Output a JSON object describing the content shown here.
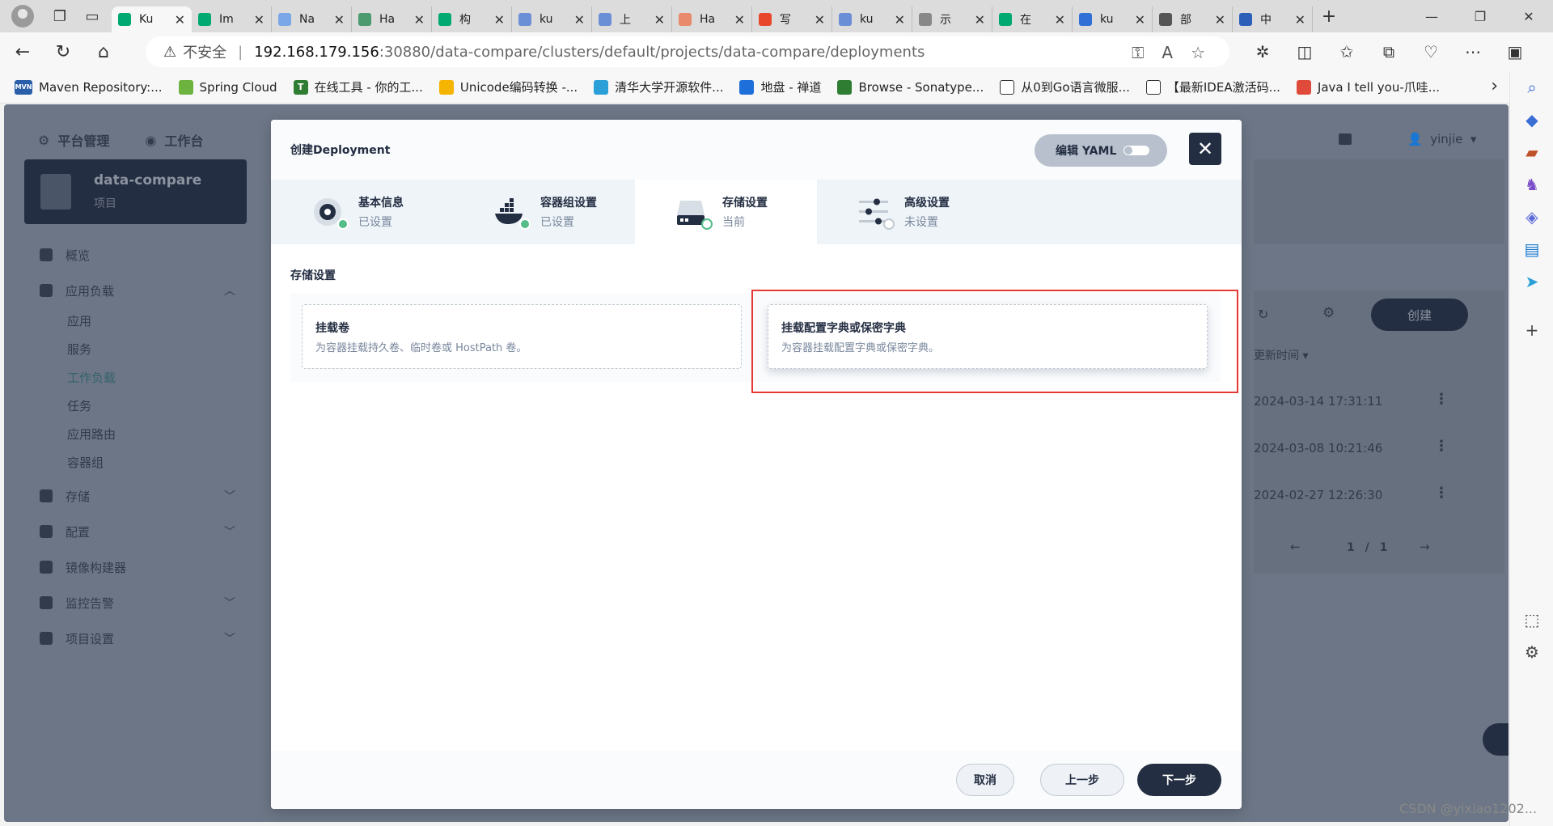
{
  "browser": {
    "tabs": [
      {
        "label": "Ku",
        "color": "#00a971",
        "active": true
      },
      {
        "label": "Im",
        "color": "#00a971"
      },
      {
        "label": "Na",
        "color": "#7aa7e8"
      },
      {
        "label": "Ha",
        "color": "#4b9b6e"
      },
      {
        "label": "构",
        "color": "#00a971"
      },
      {
        "label": "ku",
        "color": "#6b8fd6"
      },
      {
        "label": "上",
        "color": "#6b8fd6"
      },
      {
        "label": "Ha",
        "color": "#e88a6b"
      },
      {
        "label": "写",
        "color": "#e8472b"
      },
      {
        "label": "ku",
        "color": "#6b8fd6"
      },
      {
        "label": "示",
        "color": "#888888"
      },
      {
        "label": "在",
        "color": "#00a971"
      },
      {
        "label": "ku",
        "color": "#2f6fd6"
      },
      {
        "label": "部",
        "color": "#555555"
      },
      {
        "label": "中",
        "color": "#2b5fb8"
      }
    ],
    "url": {
      "warning": "不安全",
      "host": "192.168.179.156",
      "path": ":30880/data-compare/clusters/default/projects/data-compare/deployments"
    },
    "bookmarks": [
      {
        "label": "Maven Repository:...",
        "icon": "MVN",
        "color": "#2a5ea8"
      },
      {
        "label": "Spring Cloud",
        "icon": "",
        "color": "#6db33f"
      },
      {
        "label": "在线工具 - 你的工...",
        "icon": "T",
        "color": "#2e7d32"
      },
      {
        "label": "Unicode编码转换 -...",
        "icon": "",
        "color": "#f4b400"
      },
      {
        "label": "清华大学开源软件...",
        "icon": "",
        "color": "#2a9fd8"
      },
      {
        "label": "地盘 - 禅道",
        "icon": "",
        "color": "#1e6fd9"
      },
      {
        "label": "Browse - Sonatype...",
        "icon": "",
        "color": "#2e7d32"
      },
      {
        "label": "从0到Go语言微服...",
        "icon": "",
        "color": "#ffffff"
      },
      {
        "label": "【最新IDEA激活码...",
        "icon": "",
        "color": "#ffffff"
      },
      {
        "label": "Java I tell you-爪哇...",
        "icon": "",
        "color": "#e04a3a"
      }
    ]
  },
  "app": {
    "nav": {
      "platform": "平台管理",
      "workbench": "工作台",
      "user": "yinjie"
    },
    "project": {
      "name": "data-compare",
      "sub": "项目"
    },
    "menu": [
      {
        "label": "概览"
      },
      {
        "label": "应用负载",
        "expanded": true,
        "children": [
          "应用",
          "服务",
          "工作负载",
          "任务",
          "应用路由",
          "容器组"
        ]
      },
      {
        "label": "存储"
      },
      {
        "label": "配置"
      },
      {
        "label": "镜像构建器"
      },
      {
        "label": "监控告警"
      },
      {
        "label": "项目设置"
      }
    ],
    "bg": {
      "create": "创建",
      "update_col": "更新时间",
      "times": [
        "2024-03-14 17:31:11",
        "2024-03-08 10:21:46",
        "2024-02-27 12:26:30"
      ],
      "page": "1 / 1"
    }
  },
  "modal": {
    "title": "创建Deployment",
    "yaml": "编辑 YAML",
    "steps": [
      {
        "title": "基本信息",
        "state": "已设置",
        "status": "done"
      },
      {
        "title": "容器组设置",
        "state": "已设置",
        "status": "done"
      },
      {
        "title": "存储设置",
        "state": "当前",
        "status": "current"
      },
      {
        "title": "高级设置",
        "state": "未设置",
        "status": "todo"
      }
    ],
    "section": "存储设置",
    "options": [
      {
        "title": "挂载卷",
        "desc": "为容器挂载持久卷、临时卷或 HostPath 卷。"
      },
      {
        "title": "挂载配置字典或保密字典",
        "desc": "为容器挂载配置字典或保密字典。"
      }
    ],
    "footer": {
      "cancel": "取消",
      "prev": "上一步",
      "next": "下一步"
    }
  },
  "watermark": "CSDN @yixiao1202..."
}
